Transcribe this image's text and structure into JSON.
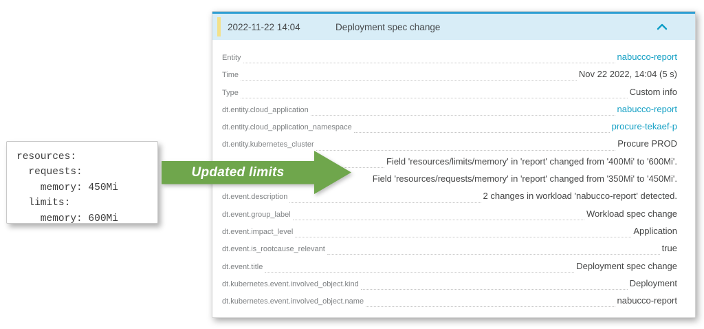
{
  "annotation": {
    "code_lines": [
      "resources:",
      "  requests:",
      "    memory: 450Mi",
      "  limits:",
      "    memory: 600Mi"
    ],
    "arrow_label": "Updated limits",
    "arrow_color": "#6fa64c"
  },
  "panel": {
    "header": {
      "timestamp": "2022-11-22 14:04",
      "title": "Deployment spec change",
      "collapse_icon": "chevron-up",
      "background_color": "#d8edf7",
      "top_border_color": "#2f9fd3",
      "marker_color": "#f3e18a",
      "chevron_color": "#0d9dc6"
    },
    "link_color": "#129fc4",
    "rows": [
      {
        "key": "Entity",
        "value": "nabucco-report",
        "link": true,
        "leader": true
      },
      {
        "key": "Time",
        "value": "Nov 22 2022, 14:04 (5 s)",
        "link": false,
        "leader": true
      },
      {
        "key": "Type",
        "value": "Custom info",
        "link": false,
        "leader": true
      },
      {
        "key": "dt.entity.cloud_application",
        "value": "nabucco-report",
        "link": true,
        "leader": true
      },
      {
        "key": "dt.entity.cloud_application_namespace",
        "value": "procure-tekaef-p",
        "link": true,
        "leader": true
      },
      {
        "key": "dt.entity.kubernetes_cluster",
        "value": "Procure PROD",
        "link": false,
        "leader": true
      },
      {
        "key": "",
        "value": "Field 'resources/limits/memory' in 'report' changed from '400Mi' to '600Mi'.",
        "link": false,
        "leader": true
      },
      {
        "key": null,
        "value": "Field 'resources/requests/memory' in 'report' changed from '350Mi' to '450Mi'.",
        "link": false,
        "leader": false
      },
      {
        "key": "dt.event.description",
        "value": "2 changes in workload 'nabucco-report' detected.",
        "link": false,
        "leader": true
      },
      {
        "key": "dt.event.group_label",
        "value": "Workload spec change",
        "link": false,
        "leader": true
      },
      {
        "key": "dt.event.impact_level",
        "value": "Application",
        "link": false,
        "leader": true
      },
      {
        "key": "dt.event.is_rootcause_relevant",
        "value": "true",
        "link": false,
        "leader": true
      },
      {
        "key": "dt.event.title",
        "value": "Deployment spec change",
        "link": false,
        "leader": true
      },
      {
        "key": "dt.kubernetes.event.involved_object.kind",
        "value": "Deployment",
        "link": false,
        "leader": true
      },
      {
        "key": "dt.kubernetes.event.involved_object.name",
        "value": "nabucco-report",
        "link": false,
        "leader": true
      }
    ]
  }
}
